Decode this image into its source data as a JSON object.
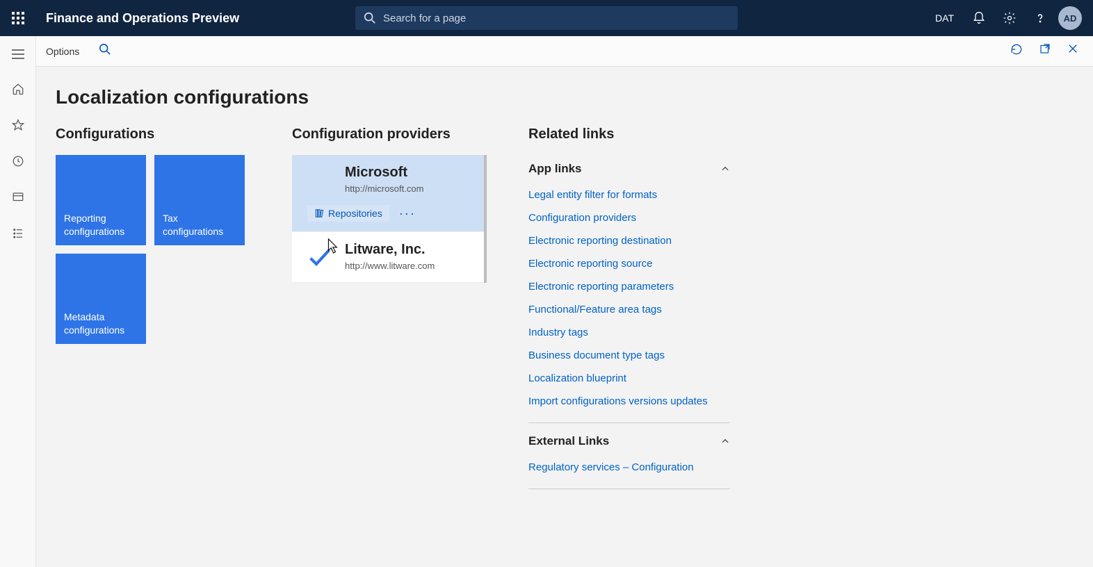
{
  "header": {
    "app_title": "Finance and Operations Preview",
    "search_placeholder": "Search for a page",
    "entity": "DAT",
    "avatar": "AD"
  },
  "cmdbar": {
    "options": "Options"
  },
  "page": {
    "title": "Localization configurations"
  },
  "configurations": {
    "title": "Configurations",
    "tiles": [
      "Reporting configurations",
      "Tax configurations",
      "Metadata configurations"
    ]
  },
  "providers": {
    "title": "Configuration providers",
    "repo_label": "Repositories",
    "items": [
      {
        "name": "Microsoft",
        "url": "http://microsoft.com",
        "selected": true,
        "active": false
      },
      {
        "name": "Litware, Inc.",
        "url": "http://www.litware.com",
        "selected": false,
        "active": true
      }
    ]
  },
  "related": {
    "title": "Related links",
    "app_links_title": "App links",
    "app_links": [
      "Legal entity filter for formats",
      "Configuration providers",
      "Electronic reporting destination",
      "Electronic reporting source",
      "Electronic reporting parameters",
      "Functional/Feature area tags",
      "Industry tags",
      "Business document type tags",
      "Localization blueprint",
      "Import configurations versions updates"
    ],
    "external_title": "External Links",
    "external_links": [
      "Regulatory services – Configuration"
    ]
  }
}
